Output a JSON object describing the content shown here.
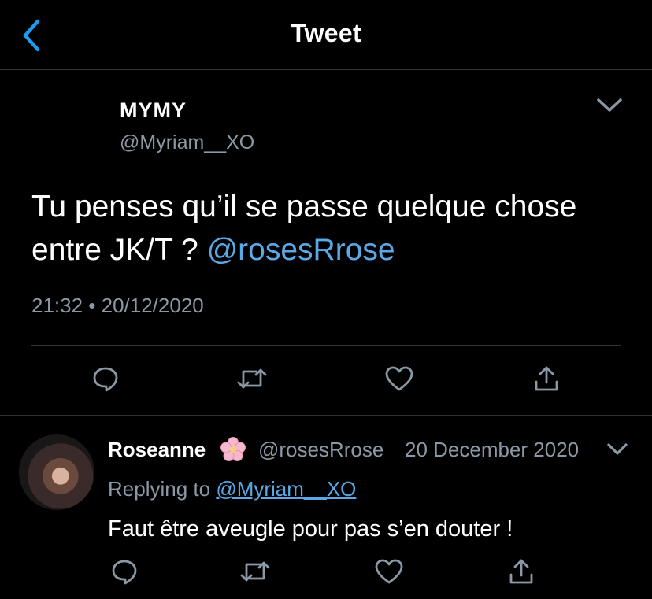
{
  "header": {
    "title": "Tweet",
    "back_icon": "chevron-left-icon"
  },
  "main_tweet": {
    "display_name": "MYMY",
    "handle": "@Myriam__XO",
    "text": "Tu penses qu’il se passe quelque chose entre JK/T ?",
    "mention": "@rosesRrose",
    "timestamp": "21:32 • 20/12/2020",
    "actions": [
      "reply-icon",
      "retweet-icon",
      "like-icon",
      "share-icon"
    ]
  },
  "reply": {
    "display_name": "Roseanne",
    "emoji": "🌸",
    "handle": "@rosesRrose",
    "date": "20 December 2020",
    "replying_prefix": "Replying to",
    "replying_to": "@Myriam__XO",
    "text": "Faut être aveugle pour pas s’en douter !",
    "actions": [
      "reply-icon",
      "retweet-icon",
      "like-icon",
      "share-icon"
    ]
  },
  "colors": {
    "background": "#000000",
    "accent": "#1d9bf0",
    "mention": "#5aa9e6",
    "secondary_text": "#8b98a5",
    "divider": "#2f3336"
  }
}
